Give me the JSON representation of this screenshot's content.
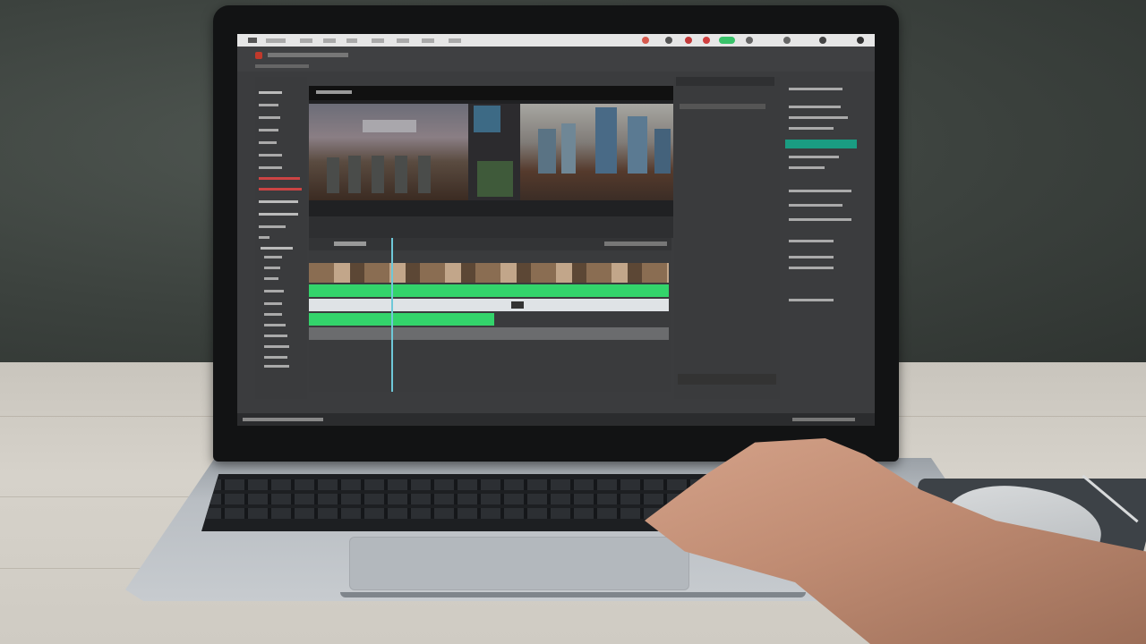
{
  "scene": {
    "description_free": true
  },
  "editor": {
    "menubar": {
      "items": [
        "",
        "",
        "",
        "",
        "",
        "",
        "",
        ""
      ]
    },
    "viewer": {
      "header_label": "",
      "overlay_text": ""
    },
    "left_panel": {
      "items": [
        "",
        "",
        "",
        "",
        "",
        "",
        "",
        "",
        "",
        "",
        "",
        "",
        "",
        "",
        "",
        "",
        "",
        "",
        "",
        "",
        "",
        ""
      ]
    },
    "right_panel": {
      "rows": [
        "",
        "",
        "",
        "",
        "",
        "",
        "",
        "",
        "",
        "",
        "",
        "",
        ""
      ]
    },
    "inspector": {
      "rows": [
        "",
        ""
      ]
    },
    "status": ""
  },
  "colors": {
    "accent_green": "#33d46b",
    "accent_teal": "#1a9c82",
    "playhead": "#6ec8d8",
    "panel": "#3a3b3d"
  }
}
